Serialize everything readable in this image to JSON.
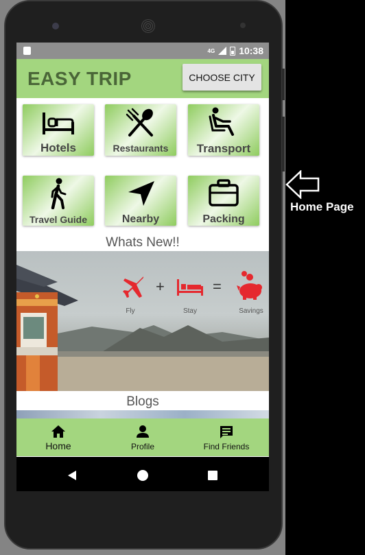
{
  "status_bar": {
    "network": "4G",
    "time": "10:38"
  },
  "app_bar": {
    "title": "EASY TRIP",
    "choose_city_label": "CHOOSE CITY"
  },
  "categories": [
    {
      "label": "Hotels",
      "icon": "bed-icon"
    },
    {
      "label": "Restaurants",
      "icon": "fork-knife-icon"
    },
    {
      "label": "Transport",
      "icon": "seat-icon"
    },
    {
      "label": "Travel Guide",
      "icon": "walking-person-icon"
    },
    {
      "label": "Nearby",
      "icon": "navigation-arrow-icon"
    },
    {
      "label": "Packing",
      "icon": "suitcase-icon"
    }
  ],
  "whats_new": {
    "heading": "Whats New!!"
  },
  "banner": {
    "items": [
      "Fly",
      "Stay",
      "Savings"
    ],
    "plus": "+",
    "equals": "=",
    "accent_color": "#e5282e"
  },
  "blogs": {
    "heading": "Blogs"
  },
  "bottom_nav": [
    {
      "label": "Home",
      "icon": "home-icon"
    },
    {
      "label": "Profile",
      "icon": "person-icon"
    },
    {
      "label": "Find Friends",
      "icon": "chat-icon"
    }
  ],
  "annotation": {
    "text": "Home Page"
  },
  "colors": {
    "app_green": "#a3d67f",
    "title_green": "#4a6638"
  }
}
